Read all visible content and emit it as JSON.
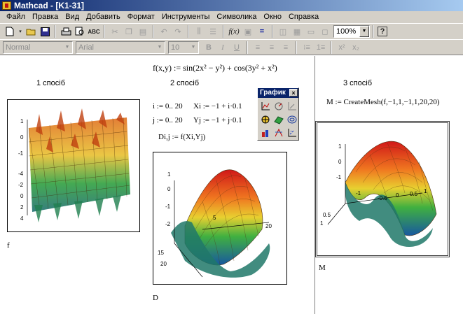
{
  "window": {
    "title": "Mathcad - [K1-31]"
  },
  "menu": [
    "Файл",
    "Правка",
    "Вид",
    "Добавить",
    "Формат",
    "Инструменты",
    "Символика",
    "Окно",
    "Справка"
  ],
  "toolbar": {
    "icons": [
      "new-icon",
      "open-icon",
      "save-icon",
      "print-icon",
      "print-preview-icon",
      "spell-check-icon",
      "cut-icon",
      "copy-icon",
      "paste-icon",
      "undo-icon",
      "redo-icon",
      "align-icon",
      "align-down-icon",
      "insert-function-icon",
      "insert-unit-icon",
      "calculate-icon",
      "insert-graph-icon",
      "insert-matrix-icon",
      "component-icon",
      "resource-icon",
      "help-icon"
    ],
    "zoom": "100%"
  },
  "format_bar": {
    "style": "Normal",
    "font": "Arial",
    "size": "10"
  },
  "worksheet": {
    "function_def": "f(x,y) := sin(2x² − y²) + cos(3y² + x²)",
    "method1": {
      "heading": "1 спосіб",
      "caption": "f",
      "y_ticks": [
        "1",
        "0",
        "-1",
        "-4",
        "-2",
        "0",
        "2",
        "4"
      ]
    },
    "method2": {
      "heading": "2 спосіб",
      "range_i": "i := 0.. 20",
      "range_j": "j := 0.. 20",
      "x_def": "Xi := −1 + i·0.1",
      "y_def": "Yj := −1 + j·0.1",
      "d_def": "Di,j := f(Xi,Yj)",
      "caption": "D",
      "z_ticks": [
        "1",
        "0",
        "-1",
        "-2"
      ],
      "x_ticks": [
        "5",
        "20",
        "15",
        "20"
      ]
    },
    "method3": {
      "heading": "3 спосіб",
      "mesh_def": "M := CreateMesh(f,−1,1,−1,1,20,20)",
      "caption": "M",
      "z_ticks": [
        "1",
        "0",
        "-1"
      ],
      "x_ticks": [
        "-1",
        "-0.5",
        "0",
        "0.5",
        "1"
      ],
      "y_ticks": [
        "0.5",
        "1"
      ]
    }
  },
  "graph_palette": {
    "title": "График",
    "close": "×"
  }
}
